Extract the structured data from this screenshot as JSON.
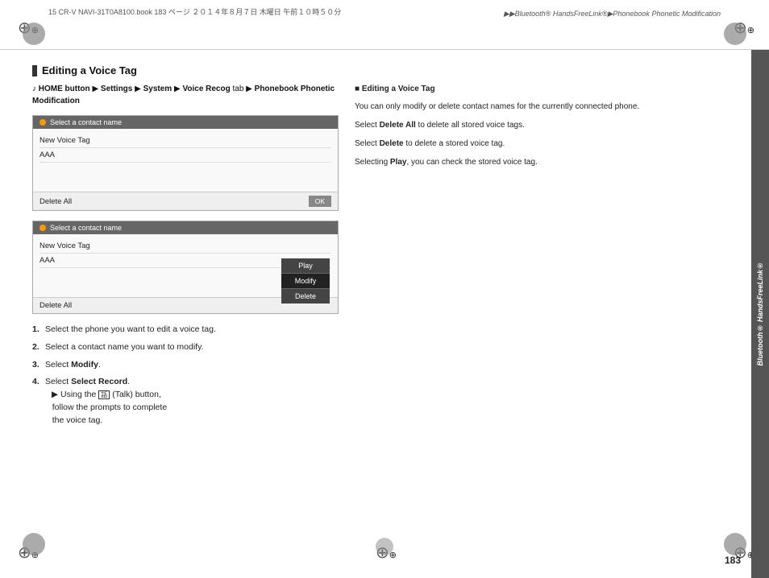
{
  "page": {
    "number": "183",
    "file_info": "15 CR-V NAVI-31T0A8100.book   183 ページ   ２０１４年８月７日   木曜日   午前１０時５０分",
    "breadcrumb": "▶▶Bluetooth® HandsFreeLink®▶Phonebook Phonetic Modification"
  },
  "section": {
    "title": "Editing a Voice Tag"
  },
  "nav_path": {
    "mic_icon": "♪",
    "text": "HOME button ▶ Settings ▶ System ▶ Voice Recog tab ▶ Phonebook Phonetic Modification"
  },
  "screen1": {
    "header_dot": "●",
    "header_text": "Select a contact name",
    "rows": [
      "New Voice Tag",
      "AAA"
    ],
    "footer_left": "Delete All",
    "footer_right": "OK"
  },
  "screen2": {
    "header_dot": "●",
    "header_text": "Select a contact name",
    "rows": [
      "New Voice Tag",
      "AAA"
    ],
    "footer_left": "Delete All",
    "popup": {
      "items": [
        "Play",
        "Modify",
        "Delete"
      ]
    }
  },
  "steps": [
    {
      "num": "1.",
      "text": "Select the phone you want to edit a voice tag."
    },
    {
      "num": "2.",
      "text": "Select a contact name you want to modify."
    },
    {
      "num": "3.",
      "text": "Select Modify."
    },
    {
      "num": "4.",
      "text": "Select Record.",
      "sub": "▶ Using the (Talk) button, follow the prompts to complete the voice tag."
    }
  ],
  "info_box": {
    "title": "■ Editing a Voice Tag",
    "para1": "You can only modify or delete contact names for the currently connected phone.",
    "para2": "Select Delete All to delete all stored voice tags.",
    "para3": "Select Delete to delete a stored voice tag.",
    "para4": "Selecting Play, you can check the stored voice tag."
  },
  "sidebar_tab": {
    "label": "Bluetooth® HandsFreeLink®"
  },
  "select_record_label": "Select Record"
}
